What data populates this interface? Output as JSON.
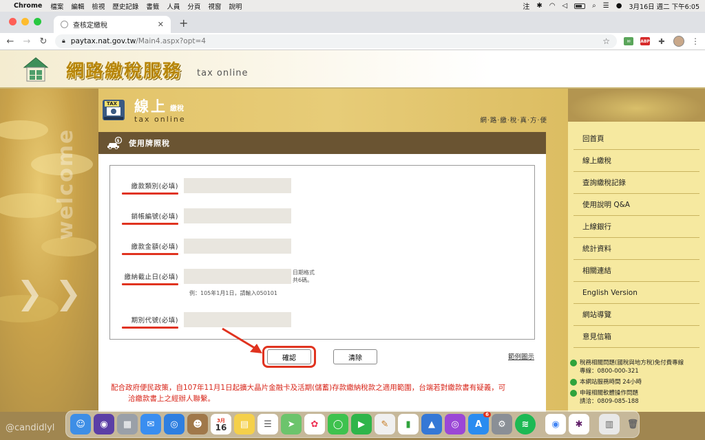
{
  "menubar": {
    "app": "Chrome",
    "items": [
      "檔案",
      "編輯",
      "檢視",
      "歷史記錄",
      "書籤",
      "人員",
      "分頁",
      "視窗",
      "說明"
    ],
    "input_method": "注",
    "datetime": "3月16日 週二 下午6:05"
  },
  "browser": {
    "tab_title": "查核定繳稅",
    "url_host": "paytax.nat.gov.tw",
    "url_path": "/Main4.aspx?opt=4",
    "ext_abp": "ABP"
  },
  "banner": {
    "title": "網路繳稅服務",
    "subtitle": "tax online"
  },
  "section": {
    "tax_label": "TAX",
    "title": "線上",
    "title_small": "繳稅",
    "title_en": "tax online",
    "slogan": "網‧路‧繳‧稅‧真‧方‧便",
    "panel_title": "使用牌照稅"
  },
  "form": {
    "fields": [
      {
        "label": "繳款類別(必填)",
        "value": ""
      },
      {
        "label": "銷帳編號(必填)",
        "value": ""
      },
      {
        "label": "繳款金額(必填)",
        "value": ""
      },
      {
        "label": "繳納截止日(必填)",
        "value": "",
        "hint_line1": "日期格式",
        "hint_line2": "共6碼。"
      },
      {
        "label": "期別代號(必填)",
        "value": ""
      }
    ],
    "example": "例：105年1月1日，請輸入050101",
    "confirm": "確認",
    "clear": "清除",
    "sample_link": "範例圖示"
  },
  "notice": {
    "line1": "配合政府便民政策，自107年11月1日起擴大晶片金融卡及活期(儲蓄)存款繳納稅款之適用範圍，台端若對繳款書有疑義，可",
    "line2": "洽繳款書上之經辦人聯繫。"
  },
  "sidebar": {
    "menu": [
      "回首頁",
      "線上繳稅",
      "查詢繳稅記錄",
      "使用說明 Q&A",
      "上線銀行",
      "統計資料",
      "相關連結",
      "English Version",
      "網站導覽",
      "意見信箱"
    ],
    "info": [
      {
        "title": "稅務相關問題(國稅與地方稅)免付費專線",
        "detail": "專線：0800-000-321"
      },
      {
        "title": "本網站服務時間 24小時",
        "detail": ""
      },
      {
        "title": "申報相關軟體操作問題",
        "detail": "請洽：0809-085-188"
      }
    ]
  },
  "leftdeco": {
    "welcome": "welcome"
  },
  "dock": {
    "calendar_month": "3月",
    "calendar_day": "16",
    "appstore_badge": "6"
  },
  "watermark": "@candidlyl",
  "colors": {
    "accent_red": "#e0331f",
    "panel_head": "#6a5432",
    "gold": "#e3c46a"
  }
}
